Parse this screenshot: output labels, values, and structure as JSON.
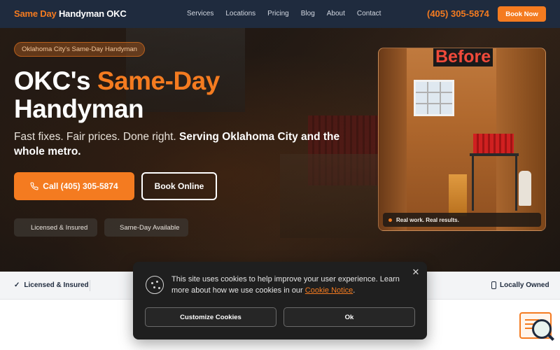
{
  "header": {
    "logo_part1": "Same Day",
    "logo_part2": "Handyman OKC",
    "nav": [
      "Services",
      "Locations",
      "Pricing",
      "Blog",
      "About",
      "Contact"
    ],
    "phone": "(405) 305-5874",
    "book_label": "Book Now"
  },
  "hero": {
    "badge": "Oklahoma City's Same-Day Handyman",
    "title_part1": "OKC's ",
    "title_accent": "Same-Day",
    "title_part2": "Handyman",
    "sub_plain": "Fast fixes. Fair prices. Done right. ",
    "sub_bold": "Serving Oklahoma City and the whole metro.",
    "call_label": "Call (405) 305-5874",
    "book_label": "Book Online",
    "pill_licensed": "Licensed & Insured",
    "pill_sameday": "Same-Day Available",
    "before_label": "Before",
    "real_text": "Real work. Real results."
  },
  "trust": {
    "item1": "Licensed & Insured",
    "item2": "Locally Owned"
  },
  "cookie": {
    "text_before": "This site uses cookies to help improve your user experience. Learn more about how we use cookies in our ",
    "link": "Cookie Notice",
    "text_after": ".",
    "customize": "Customize Cookies",
    "ok": "Ok"
  },
  "colors": {
    "accent": "#f47b20",
    "navy": "#1f2b3e"
  }
}
